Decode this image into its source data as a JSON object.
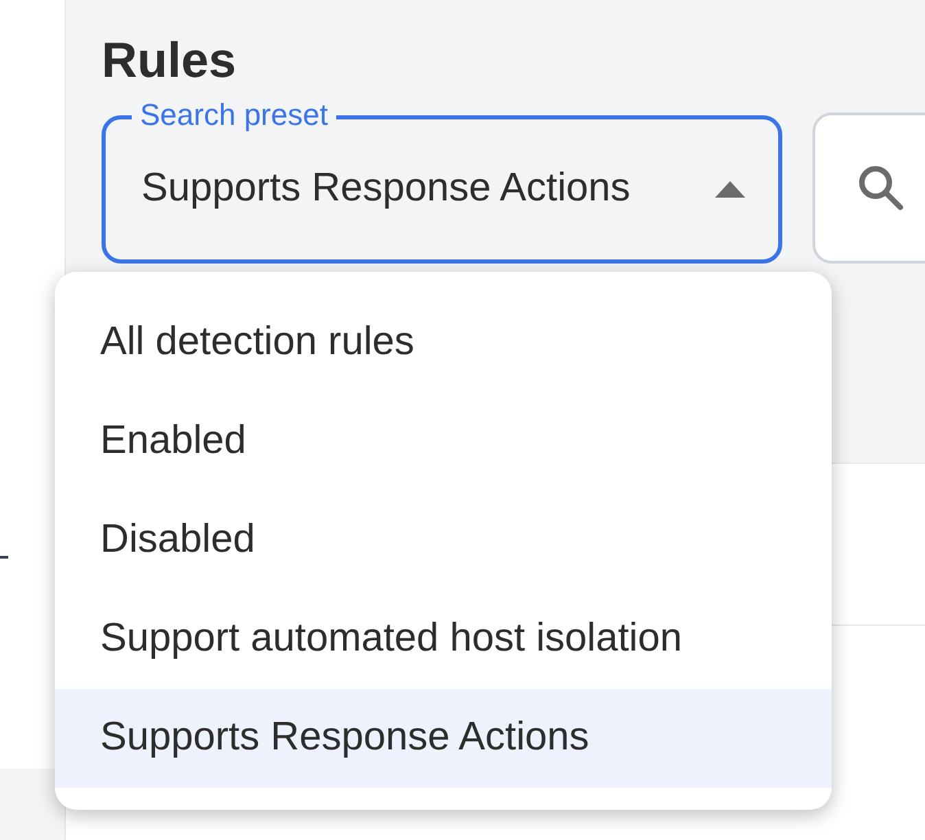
{
  "page": {
    "title": "Rules"
  },
  "search_preset": {
    "label": "Search preset",
    "value": "Supports Response Actions",
    "expanded": true
  },
  "menu": [
    {
      "label": "All detection rules",
      "selected": false
    },
    {
      "label": "Enabled",
      "selected": false
    },
    {
      "label": "Disabled",
      "selected": false
    },
    {
      "label": "Support automated host isolation",
      "selected": false
    },
    {
      "label": "Supports Response Actions",
      "selected": true
    }
  ]
}
